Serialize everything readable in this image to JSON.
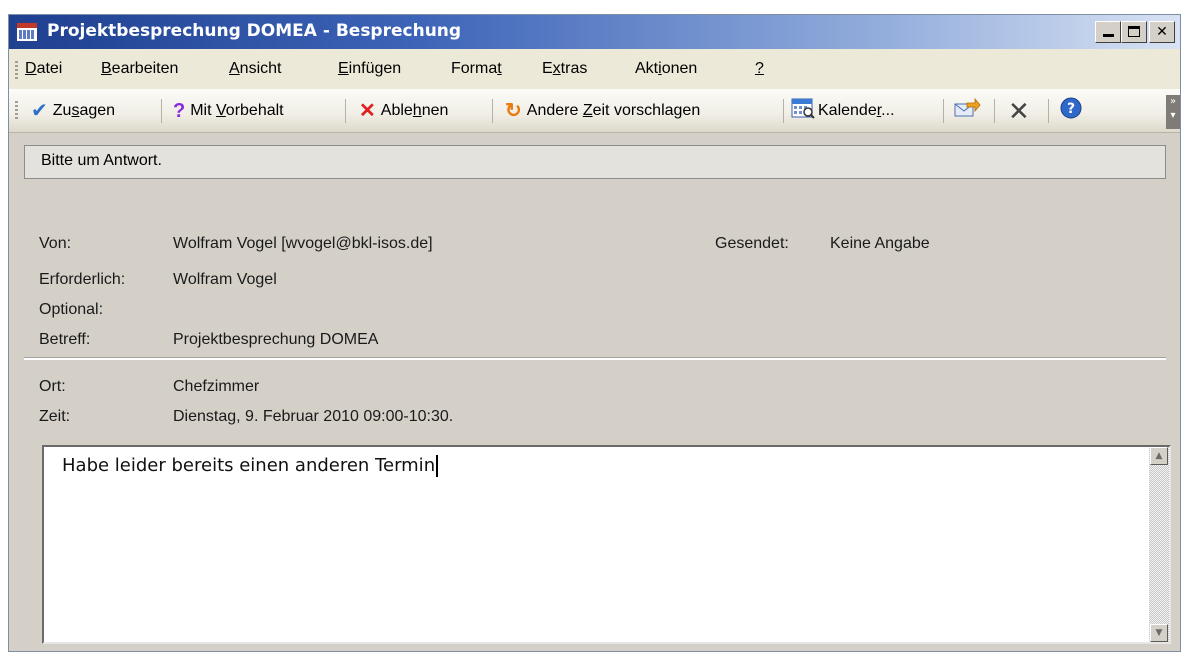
{
  "window": {
    "title": "Projektbesprechung DOMEA - Besprechung"
  },
  "menu": [
    {
      "pre": "",
      "u": "D",
      "post": "atei"
    },
    {
      "pre": "",
      "u": "B",
      "post": "earbeiten"
    },
    {
      "pre": "",
      "u": "A",
      "post": "nsicht"
    },
    {
      "pre": "",
      "u": "E",
      "post": "infügen"
    },
    {
      "pre": "Forma",
      "u": "t",
      "post": ""
    },
    {
      "pre": "E",
      "u": "x",
      "post": "tras"
    },
    {
      "pre": "Akt",
      "u": "i",
      "post": "onen"
    },
    {
      "pre": "",
      "u": "?",
      "post": ""
    }
  ],
  "toolbar": {
    "accept": {
      "pre": "Zu",
      "u": "s",
      "post": "agen"
    },
    "tentative": {
      "pre": "Mit ",
      "u": "V",
      "post": "orbehalt"
    },
    "decline": {
      "pre": "Able",
      "u": "h",
      "post": "nen"
    },
    "propose": {
      "pre": "Andere ",
      "u": "Z",
      "post": "eit vorschlagen"
    },
    "calendar": {
      "pre": "Kalende",
      "u": "r",
      "post": "..."
    }
  },
  "info_bar": "Bitte um Antwort.",
  "header": {
    "from_label": "Von:",
    "from_value": "Wolfram Vogel [wvogel@bkl-isos.de]",
    "sent_label": "Gesendet:",
    "sent_value": "Keine Angabe",
    "required_label": "Erforderlich:",
    "required_value": "Wolfram Vogel",
    "optional_label": "Optional:",
    "optional_value": "",
    "subject_label": "Betreff:",
    "subject_value": "Projektbesprechung DOMEA",
    "location_label": "Ort:",
    "location_value": "Chefzimmer",
    "time_label": "Zeit:",
    "time_value": "Dienstag, 9. Februar 2010 09:00-10:30."
  },
  "body_text": "Habe leider bereits einen anderen Termin",
  "icons": {
    "accept": "checkmark-icon",
    "tentative": "question-mark-icon",
    "decline": "x-icon",
    "propose": "propose-time-icon",
    "calendar": "calendar-icon",
    "forward": "forward-icon",
    "delete": "delete-icon",
    "help": "help-icon"
  },
  "colors": {
    "titlebar_start": "#1f3f8f",
    "accept": "#2e6fcc",
    "tentative": "#8a2be2",
    "decline": "#e02020",
    "propose": "#e87a10"
  }
}
